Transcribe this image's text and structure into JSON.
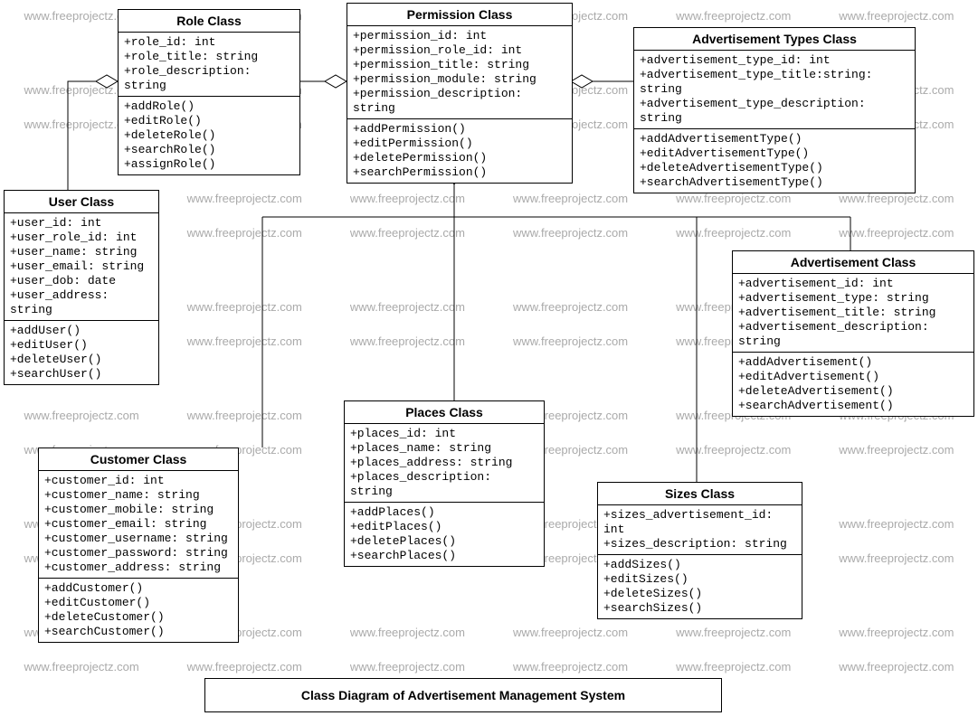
{
  "diagram_title": "Class Diagram of Advertisement Management System",
  "watermark": "www.freeprojectz.com",
  "classes": {
    "role": {
      "title": "Role Class",
      "attrs": [
        "+role_id: int",
        "+role_title: string",
        "+role_description: string"
      ],
      "ops": [
        "+addRole()",
        "+editRole()",
        "+deleteRole()",
        "+searchRole()",
        "+assignRole()"
      ]
    },
    "permission": {
      "title": "Permission Class",
      "attrs": [
        "+permission_id: int",
        "+permission_role_id: int",
        "+permission_title: string",
        "+permission_module: string",
        "+permission_description: string"
      ],
      "ops": [
        "+addPermission()",
        "+editPermission()",
        "+deletePermission()",
        "+searchPermission()"
      ]
    },
    "adtypes": {
      "title": "Advertisement Types Class",
      "attrs": [
        "+advertisement_type_id: int",
        "+advertisement_type_title:string: string",
        "+advertisement_type_description: string"
      ],
      "ops": [
        "+addAdvertisementType()",
        "+editAdvertisementType()",
        "+deleteAdvertisementType()",
        "+searchAdvertisementType()"
      ]
    },
    "user": {
      "title": "User Class",
      "attrs": [
        "+user_id: int",
        "+user_role_id: int",
        "+user_name: string",
        "+user_email: string",
        "+user_dob: date",
        "+user_address: string"
      ],
      "ops": [
        "+addUser()",
        "+editUser()",
        "+deleteUser()",
        "+searchUser()"
      ]
    },
    "advertisement": {
      "title": "Advertisement Class",
      "attrs": [
        "+advertisement_id: int",
        "+advertisement_type: string",
        "+advertisement_title: string",
        "+advertisement_description: string"
      ],
      "ops": [
        "+addAdvertisement()",
        "+editAdvertisement()",
        "+deleteAdvertisement()",
        "+searchAdvertisement()"
      ]
    },
    "places": {
      "title": "Places Class",
      "attrs": [
        "+places_id: int",
        "+places_name: string",
        "+places_address: string",
        "+places_description: string"
      ],
      "ops": [
        "+addPlaces()",
        "+editPlaces()",
        "+deletePlaces()",
        "+searchPlaces()"
      ]
    },
    "customer": {
      "title": "Customer Class",
      "attrs": [
        "+customer_id: int",
        "+customer_name: string",
        "+customer_mobile: string",
        "+customer_email: string",
        "+customer_username: string",
        "+customer_password: string",
        "+customer_address: string"
      ],
      "ops": [
        "+addCustomer()",
        "+editCustomer()",
        "+deleteCustomer()",
        "+searchCustomer()"
      ]
    },
    "sizes": {
      "title": "Sizes Class",
      "attrs": [
        "+sizes_advertisement_id: int",
        "+sizes_description: string"
      ],
      "ops": [
        "+addSizes()",
        "+editSizes()",
        "+deleteSizes()",
        "+searchSizes()"
      ]
    }
  }
}
